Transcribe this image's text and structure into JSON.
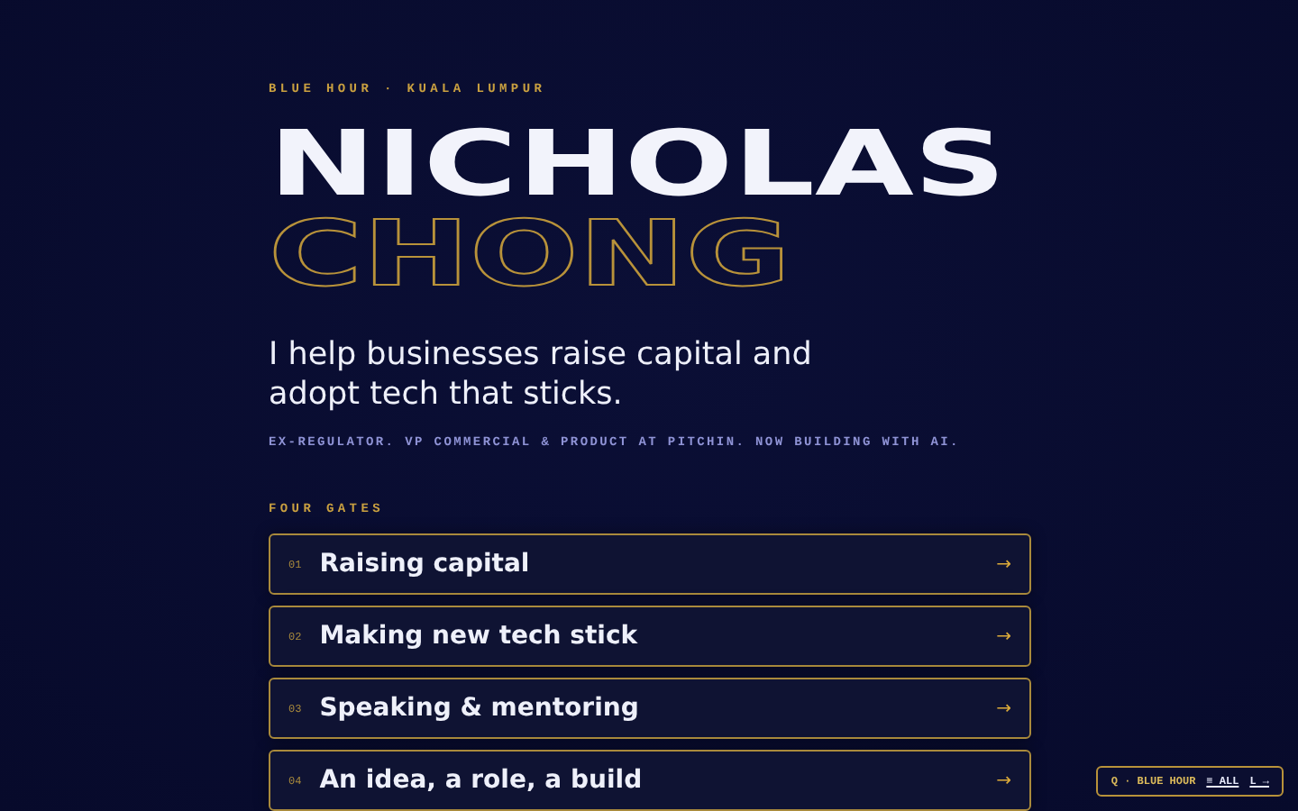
{
  "eyebrow": "BLUE HOUR · KUALA LUMPUR",
  "name": {
    "first": "NICHOLAS",
    "last": "CHONG"
  },
  "headline": "I help businesses raise capital and adopt tech that sticks.",
  "subline": "EX-REGULATOR. VP COMMERCIAL & PRODUCT AT PITCHIN. NOW BUILDING WITH AI.",
  "section_label": "FOUR GATES",
  "gates": [
    {
      "number": "01",
      "title": "Raising capital",
      "arrow": "→"
    },
    {
      "number": "02",
      "title": "Making new tech stick",
      "arrow": "→"
    },
    {
      "number": "03",
      "title": "Speaking & mentoring",
      "arrow": "→"
    },
    {
      "number": "04",
      "title": "An idea, a role, a build",
      "arrow": "→"
    }
  ],
  "theme_badge": {
    "key": "Q",
    "label": "· BLUE HOUR",
    "all_link": "≡ ALL",
    "next_link": "L →"
  }
}
